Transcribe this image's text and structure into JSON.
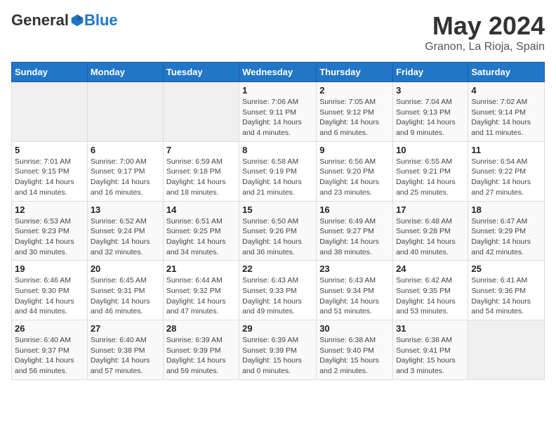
{
  "header": {
    "logo_general": "General",
    "logo_blue": "Blue",
    "month_title": "May 2024",
    "location": "Granon, La Rioja, Spain"
  },
  "weekdays": [
    "Sunday",
    "Monday",
    "Tuesday",
    "Wednesday",
    "Thursday",
    "Friday",
    "Saturday"
  ],
  "weeks": [
    [
      {
        "day": "",
        "info": ""
      },
      {
        "day": "",
        "info": ""
      },
      {
        "day": "",
        "info": ""
      },
      {
        "day": "1",
        "info": "Sunrise: 7:06 AM\nSunset: 9:11 PM\nDaylight: 14 hours\nand 4 minutes."
      },
      {
        "day": "2",
        "info": "Sunrise: 7:05 AM\nSunset: 9:12 PM\nDaylight: 14 hours\nand 6 minutes."
      },
      {
        "day": "3",
        "info": "Sunrise: 7:04 AM\nSunset: 9:13 PM\nDaylight: 14 hours\nand 9 minutes."
      },
      {
        "day": "4",
        "info": "Sunrise: 7:02 AM\nSunset: 9:14 PM\nDaylight: 14 hours\nand 11 minutes."
      }
    ],
    [
      {
        "day": "5",
        "info": "Sunrise: 7:01 AM\nSunset: 9:15 PM\nDaylight: 14 hours\nand 14 minutes."
      },
      {
        "day": "6",
        "info": "Sunrise: 7:00 AM\nSunset: 9:17 PM\nDaylight: 14 hours\nand 16 minutes."
      },
      {
        "day": "7",
        "info": "Sunrise: 6:59 AM\nSunset: 9:18 PM\nDaylight: 14 hours\nand 18 minutes."
      },
      {
        "day": "8",
        "info": "Sunrise: 6:58 AM\nSunset: 9:19 PM\nDaylight: 14 hours\nand 21 minutes."
      },
      {
        "day": "9",
        "info": "Sunrise: 6:56 AM\nSunset: 9:20 PM\nDaylight: 14 hours\nand 23 minutes."
      },
      {
        "day": "10",
        "info": "Sunrise: 6:55 AM\nSunset: 9:21 PM\nDaylight: 14 hours\nand 25 minutes."
      },
      {
        "day": "11",
        "info": "Sunrise: 6:54 AM\nSunset: 9:22 PM\nDaylight: 14 hours\nand 27 minutes."
      }
    ],
    [
      {
        "day": "12",
        "info": "Sunrise: 6:53 AM\nSunset: 9:23 PM\nDaylight: 14 hours\nand 30 minutes."
      },
      {
        "day": "13",
        "info": "Sunrise: 6:52 AM\nSunset: 9:24 PM\nDaylight: 14 hours\nand 32 minutes."
      },
      {
        "day": "14",
        "info": "Sunrise: 6:51 AM\nSunset: 9:25 PM\nDaylight: 14 hours\nand 34 minutes."
      },
      {
        "day": "15",
        "info": "Sunrise: 6:50 AM\nSunset: 9:26 PM\nDaylight: 14 hours\nand 36 minutes."
      },
      {
        "day": "16",
        "info": "Sunrise: 6:49 AM\nSunset: 9:27 PM\nDaylight: 14 hours\nand 38 minutes."
      },
      {
        "day": "17",
        "info": "Sunrise: 6:48 AM\nSunset: 9:28 PM\nDaylight: 14 hours\nand 40 minutes."
      },
      {
        "day": "18",
        "info": "Sunrise: 6:47 AM\nSunset: 9:29 PM\nDaylight: 14 hours\nand 42 minutes."
      }
    ],
    [
      {
        "day": "19",
        "info": "Sunrise: 6:46 AM\nSunset: 9:30 PM\nDaylight: 14 hours\nand 44 minutes."
      },
      {
        "day": "20",
        "info": "Sunrise: 6:45 AM\nSunset: 9:31 PM\nDaylight: 14 hours\nand 46 minutes."
      },
      {
        "day": "21",
        "info": "Sunrise: 6:44 AM\nSunset: 9:32 PM\nDaylight: 14 hours\nand 47 minutes."
      },
      {
        "day": "22",
        "info": "Sunrise: 6:43 AM\nSunset: 9:33 PM\nDaylight: 14 hours\nand 49 minutes."
      },
      {
        "day": "23",
        "info": "Sunrise: 6:43 AM\nSunset: 9:34 PM\nDaylight: 14 hours\nand 51 minutes."
      },
      {
        "day": "24",
        "info": "Sunrise: 6:42 AM\nSunset: 9:35 PM\nDaylight: 14 hours\nand 53 minutes."
      },
      {
        "day": "25",
        "info": "Sunrise: 6:41 AM\nSunset: 9:36 PM\nDaylight: 14 hours\nand 54 minutes."
      }
    ],
    [
      {
        "day": "26",
        "info": "Sunrise: 6:40 AM\nSunset: 9:37 PM\nDaylight: 14 hours\nand 56 minutes."
      },
      {
        "day": "27",
        "info": "Sunrise: 6:40 AM\nSunset: 9:38 PM\nDaylight: 14 hours\nand 57 minutes."
      },
      {
        "day": "28",
        "info": "Sunrise: 6:39 AM\nSunset: 9:39 PM\nDaylight: 14 hours\nand 59 minutes."
      },
      {
        "day": "29",
        "info": "Sunrise: 6:39 AM\nSunset: 9:39 PM\nDaylight: 15 hours\nand 0 minutes."
      },
      {
        "day": "30",
        "info": "Sunrise: 6:38 AM\nSunset: 9:40 PM\nDaylight: 15 hours\nand 2 minutes."
      },
      {
        "day": "31",
        "info": "Sunrise: 6:38 AM\nSunset: 9:41 PM\nDaylight: 15 hours\nand 3 minutes."
      },
      {
        "day": "",
        "info": ""
      }
    ]
  ]
}
